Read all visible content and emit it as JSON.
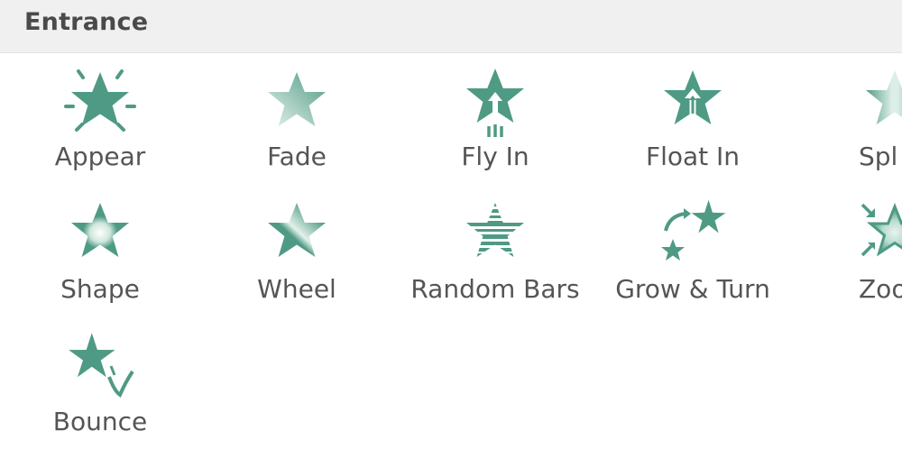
{
  "header": {
    "title": "Entrance"
  },
  "effects": [
    {
      "label": "Appear",
      "icon": "appear-star-icon"
    },
    {
      "label": "Fade",
      "icon": "fade-star-icon"
    },
    {
      "label": "Fly In",
      "icon": "fly-in-star-icon"
    },
    {
      "label": "Float In",
      "icon": "float-in-star-icon"
    },
    {
      "label": "Spl",
      "icon": "split-star-icon"
    },
    {
      "label": "Shape",
      "icon": "shape-star-icon"
    },
    {
      "label": "Wheel",
      "icon": "wheel-star-icon"
    },
    {
      "label": "Random Bars",
      "icon": "random-bars-star-icon"
    },
    {
      "label": "Grow & Turn",
      "icon": "grow-turn-star-icon"
    },
    {
      "label": "Zoo",
      "icon": "zoom-star-icon"
    },
    {
      "label": "Bounce",
      "icon": "bounce-star-icon"
    }
  ],
  "colors": {
    "accent": "#4f9a84",
    "accent_light": "#b9dccf",
    "header_bg": "#f0f0f0",
    "text": "#555555"
  }
}
